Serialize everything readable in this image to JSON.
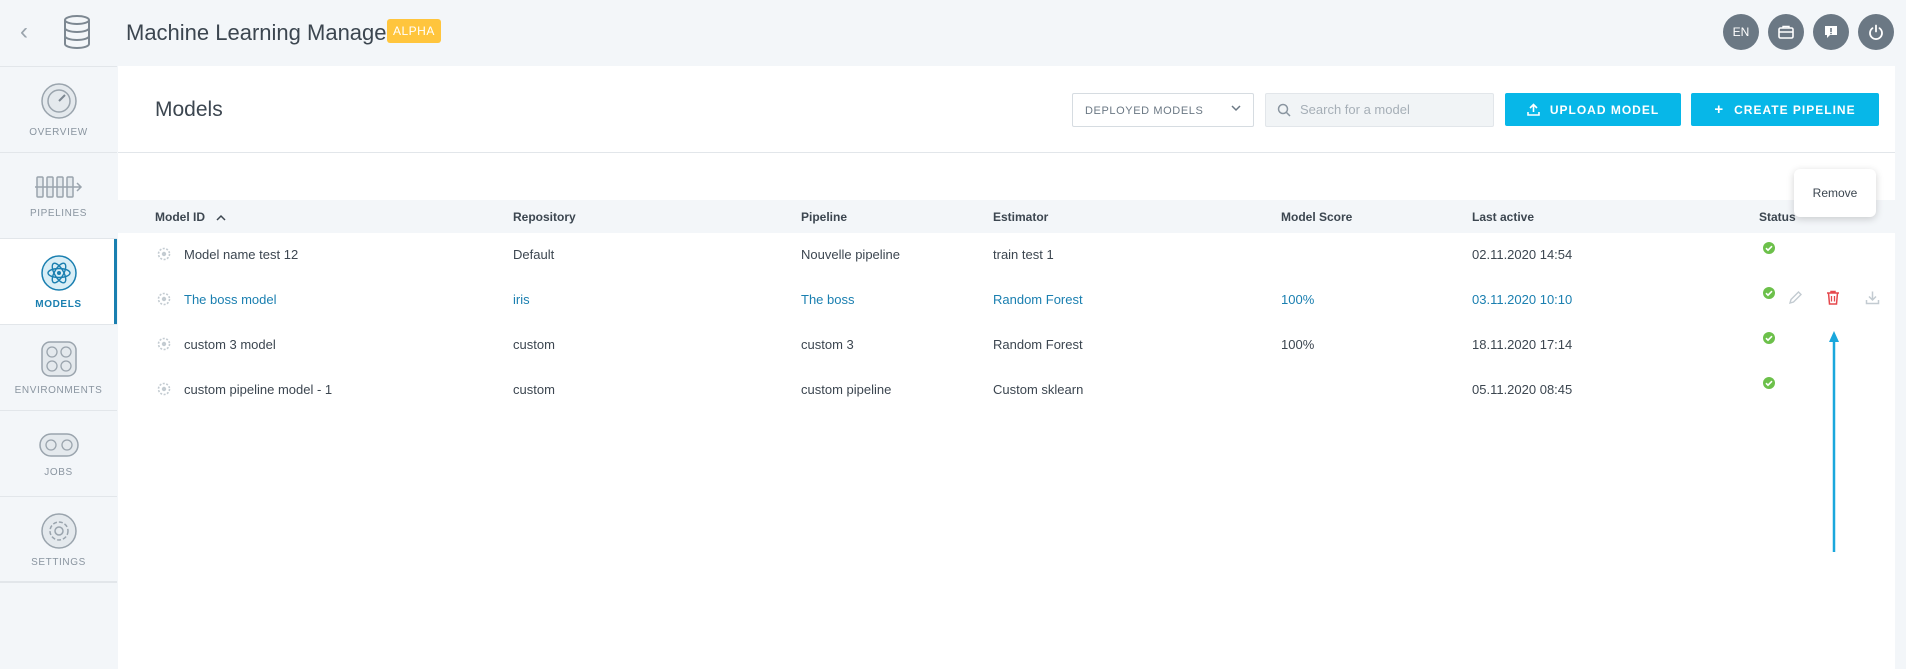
{
  "header": {
    "app_title": "Machine Learning Manager",
    "badge": "ALPHA",
    "lang": "EN"
  },
  "sidebar": {
    "items": [
      {
        "label": "OVERVIEW",
        "icon": "gauge-icon"
      },
      {
        "label": "PIPELINES",
        "icon": "pipeline-icon"
      },
      {
        "label": "MODELS",
        "icon": "atom-icon",
        "active": true
      },
      {
        "label": "ENVIRONMENTS",
        "icon": "environment-icon"
      },
      {
        "label": "JOBS",
        "icon": "jobs-icon"
      },
      {
        "label": "SETTINGS",
        "icon": "settings-icon"
      }
    ]
  },
  "main": {
    "title": "Models",
    "filter_select": "DEPLOYED MODELS",
    "search_placeholder": "Search for a model",
    "upload_label": "UPLOAD MODEL",
    "create_label": "CREATE PIPELINE"
  },
  "table": {
    "headers": {
      "model_id": "Model ID",
      "repository": "Repository",
      "pipeline": "Pipeline",
      "estimator": "Estimator",
      "score": "Model Score",
      "last_active": "Last active",
      "status": "Status"
    },
    "rows": [
      {
        "model_id": "Model name test 12",
        "repository": "Default",
        "pipeline": "Nouvelle pipeline",
        "estimator": "train test 1",
        "score": "",
        "last_active": "02.11.2020 14:54"
      },
      {
        "model_id": "The boss model",
        "repository": "iris",
        "pipeline": "The boss",
        "estimator": "Random Forest",
        "score": "100%",
        "last_active": "03.11.2020 10:10"
      },
      {
        "model_id": "custom 3 model",
        "repository": "custom",
        "pipeline": "custom 3",
        "estimator": "Random Forest",
        "score": "100%",
        "last_active": "18.11.2020 17:14"
      },
      {
        "model_id": "custom pipeline model - 1",
        "repository": "custom",
        "pipeline": "custom pipeline",
        "estimator": "Custom sklearn",
        "score": "",
        "last_active": "05.11.2020 08:45"
      }
    ]
  },
  "tooltip": "Remove",
  "colors": {
    "accent": "#07b7e8",
    "link": "#1a7fb0",
    "badge": "#ffc53d",
    "danger": "#e5484d",
    "success": "#6cc04a"
  }
}
